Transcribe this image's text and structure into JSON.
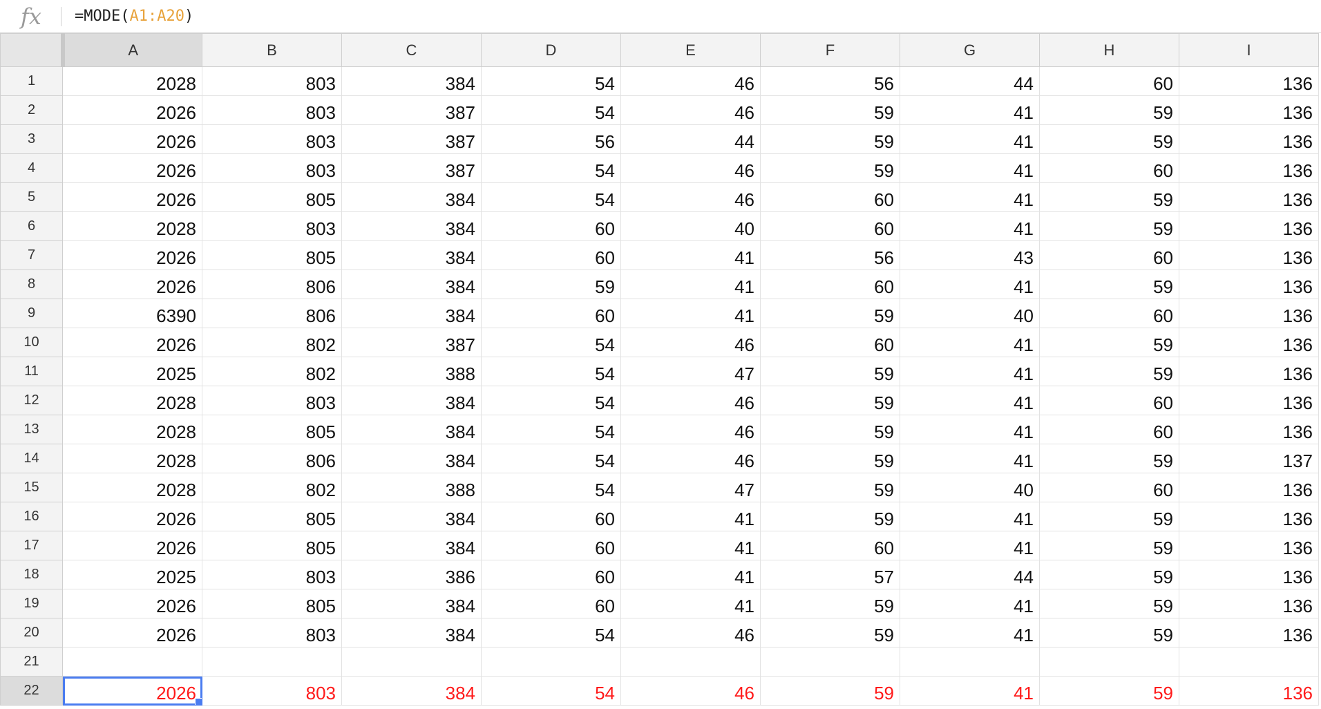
{
  "formula_bar": {
    "icon": "fx-icon",
    "prefix": "=MODE(",
    "range_start": "A1",
    "range_sep": ":",
    "range_end": "A20",
    "suffix": ")"
  },
  "columns": [
    "A",
    "B",
    "C",
    "D",
    "E",
    "F",
    "G",
    "H",
    "I"
  ],
  "selected_column": "A",
  "selected_row": 22,
  "rows": [
    {
      "num": "1",
      "cells": [
        "2028",
        "803",
        "384",
        "54",
        "46",
        "56",
        "44",
        "60",
        "136"
      ]
    },
    {
      "num": "2",
      "cells": [
        "2026",
        "803",
        "387",
        "54",
        "46",
        "59",
        "41",
        "59",
        "136"
      ]
    },
    {
      "num": "3",
      "cells": [
        "2026",
        "803",
        "387",
        "56",
        "44",
        "59",
        "41",
        "59",
        "136"
      ]
    },
    {
      "num": "4",
      "cells": [
        "2026",
        "803",
        "387",
        "54",
        "46",
        "59",
        "41",
        "60",
        "136"
      ]
    },
    {
      "num": "5",
      "cells": [
        "2026",
        "805",
        "384",
        "54",
        "46",
        "60",
        "41",
        "59",
        "136"
      ]
    },
    {
      "num": "6",
      "cells": [
        "2028",
        "803",
        "384",
        "60",
        "40",
        "60",
        "41",
        "59",
        "136"
      ]
    },
    {
      "num": "7",
      "cells": [
        "2026",
        "805",
        "384",
        "60",
        "41",
        "56",
        "43",
        "60",
        "136"
      ]
    },
    {
      "num": "8",
      "cells": [
        "2026",
        "806",
        "384",
        "59",
        "41",
        "60",
        "41",
        "59",
        "136"
      ]
    },
    {
      "num": "9",
      "cells": [
        "6390",
        "806",
        "384",
        "60",
        "41",
        "59",
        "40",
        "60",
        "136"
      ]
    },
    {
      "num": "10",
      "cells": [
        "2026",
        "802",
        "387",
        "54",
        "46",
        "60",
        "41",
        "59",
        "136"
      ]
    },
    {
      "num": "11",
      "cells": [
        "2025",
        "802",
        "388",
        "54",
        "47",
        "59",
        "41",
        "59",
        "136"
      ]
    },
    {
      "num": "12",
      "cells": [
        "2028",
        "803",
        "384",
        "54",
        "46",
        "59",
        "41",
        "60",
        "136"
      ]
    },
    {
      "num": "13",
      "cells": [
        "2028",
        "805",
        "384",
        "54",
        "46",
        "59",
        "41",
        "60",
        "136"
      ]
    },
    {
      "num": "14",
      "cells": [
        "2028",
        "806",
        "384",
        "54",
        "46",
        "59",
        "41",
        "59",
        "137"
      ]
    },
    {
      "num": "15",
      "cells": [
        "2028",
        "802",
        "388",
        "54",
        "47",
        "59",
        "40",
        "60",
        "136"
      ]
    },
    {
      "num": "16",
      "cells": [
        "2026",
        "805",
        "384",
        "60",
        "41",
        "59",
        "41",
        "59",
        "136"
      ]
    },
    {
      "num": "17",
      "cells": [
        "2026",
        "805",
        "384",
        "60",
        "41",
        "60",
        "41",
        "59",
        "136"
      ]
    },
    {
      "num": "18",
      "cells": [
        "2025",
        "803",
        "386",
        "60",
        "41",
        "57",
        "44",
        "59",
        "136"
      ]
    },
    {
      "num": "19",
      "cells": [
        "2026",
        "805",
        "384",
        "60",
        "41",
        "59",
        "41",
        "59",
        "136"
      ]
    },
    {
      "num": "20",
      "cells": [
        "2026",
        "803",
        "384",
        "54",
        "46",
        "59",
        "41",
        "59",
        "136"
      ]
    },
    {
      "num": "21",
      "cells": [
        "",
        "",
        "",
        "",
        "",
        "",
        "",
        "",
        ""
      ]
    },
    {
      "num": "22",
      "cells": [
        "2026",
        "803",
        "384",
        "54",
        "46",
        "59",
        "41",
        "59",
        "136"
      ],
      "result": true
    }
  ],
  "colors": {
    "result_text": "#ff1a1a",
    "selection": "#4a7cf0",
    "range_ref": "#e8a33d"
  }
}
